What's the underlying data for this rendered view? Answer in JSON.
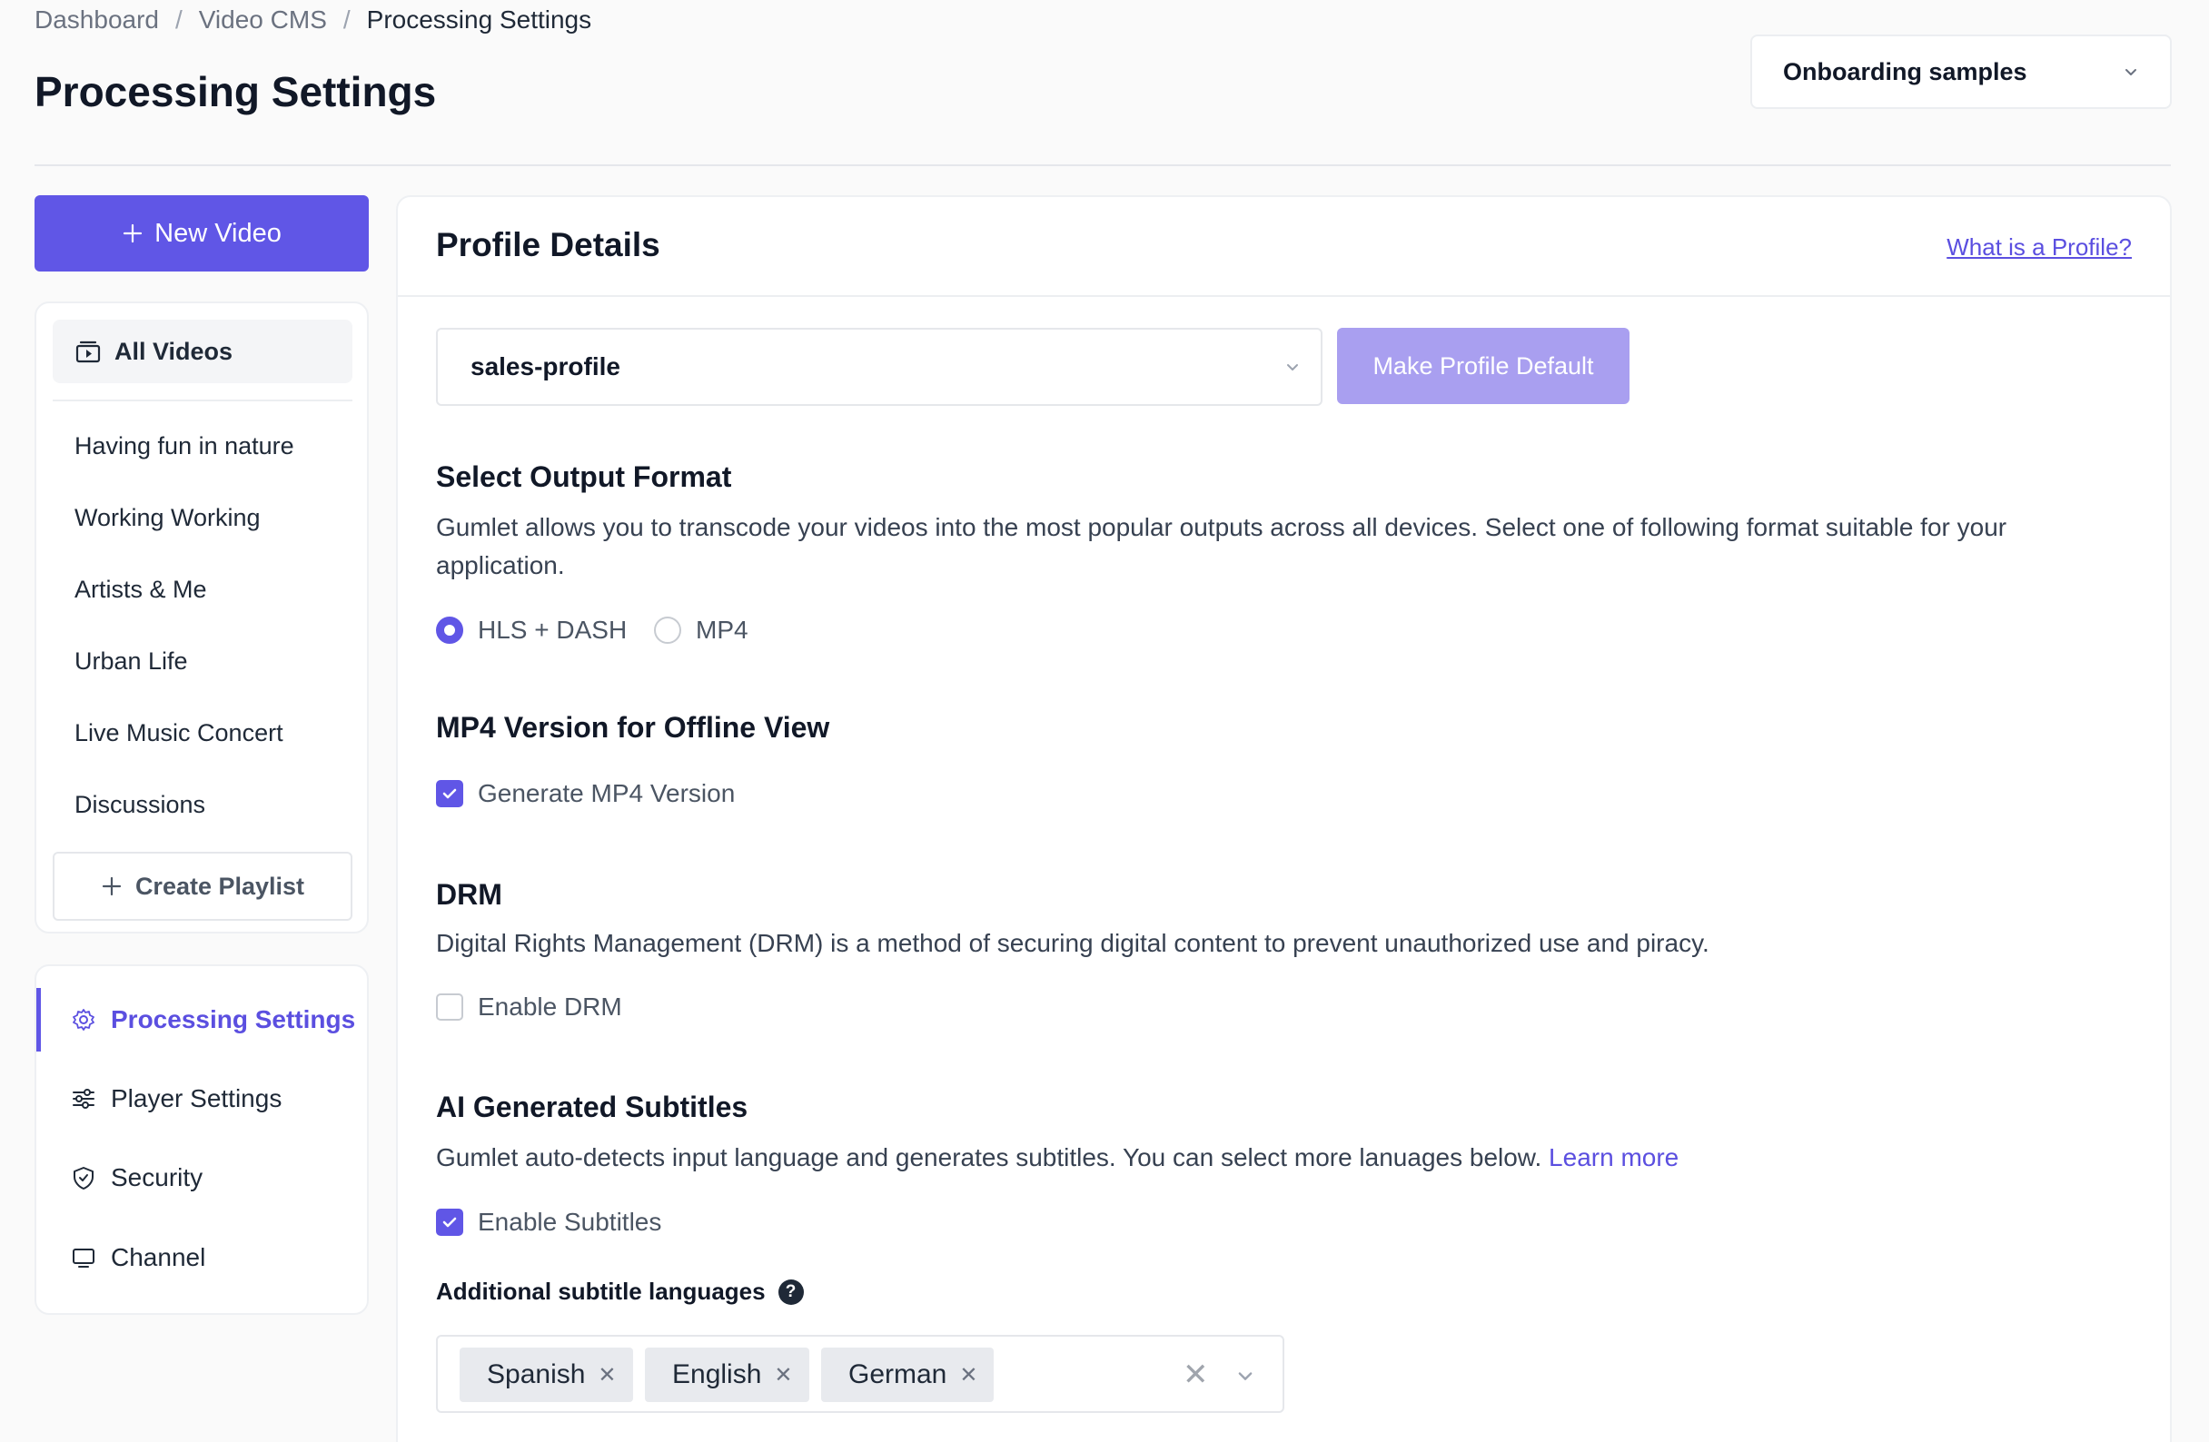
{
  "breadcrumb": {
    "items": [
      "Dashboard",
      "Video CMS",
      "Processing Settings"
    ]
  },
  "page": {
    "title": "Processing Settings"
  },
  "workspace": {
    "selected": "Onboarding samples"
  },
  "sidebar": {
    "new_video": "New Video",
    "all_videos": "All Videos",
    "playlists": [
      "Having fun in nature",
      "Working Working",
      "Artists & Me",
      "Urban Life",
      "Live Music Concert",
      "Discussions"
    ],
    "create_playlist": "Create Playlist",
    "settings": [
      {
        "label": "Processing Settings",
        "icon": "gear-icon",
        "active": true
      },
      {
        "label": "Player Settings",
        "icon": "sliders-icon",
        "active": false
      },
      {
        "label": "Security",
        "icon": "shield-icon",
        "active": false
      },
      {
        "label": "Channel",
        "icon": "monitor-icon",
        "active": false
      }
    ]
  },
  "profile": {
    "title": "Profile Details",
    "help_link": "What is a Profile?",
    "selected": "sales-profile",
    "make_default": "Make Profile Default"
  },
  "output_format": {
    "title": "Select Output Format",
    "description": "Gumlet allows you to transcode your videos into the most popular outputs across all devices. Select one of following format suitable for your application.",
    "options": [
      {
        "label": "HLS + DASH",
        "selected": true
      },
      {
        "label": "MP4",
        "selected": false
      }
    ]
  },
  "mp4_offline": {
    "title": "MP4 Version for Offline View",
    "checkbox_label": "Generate MP4 Version",
    "checked": true
  },
  "drm": {
    "title": "DRM",
    "description": "Digital Rights Management (DRM) is a method of securing digital content to prevent unauthorized use and piracy.",
    "checkbox_label": "Enable DRM",
    "checked": false
  },
  "subtitles": {
    "title": "AI Generated Subtitles",
    "description": "Gumlet auto-detects input language and generates subtitles. You can select more lanuages below.",
    "learn_more": "Learn more",
    "checkbox_label": "Enable Subtitles",
    "checked": true,
    "additional_label": "Additional subtitle languages",
    "help_glyph": "?",
    "languages": [
      "Spanish",
      "English",
      "German"
    ]
  },
  "colors": {
    "accent": "#6056e6",
    "accent_light": "#a99ff0",
    "link": "#5b4fe0"
  }
}
